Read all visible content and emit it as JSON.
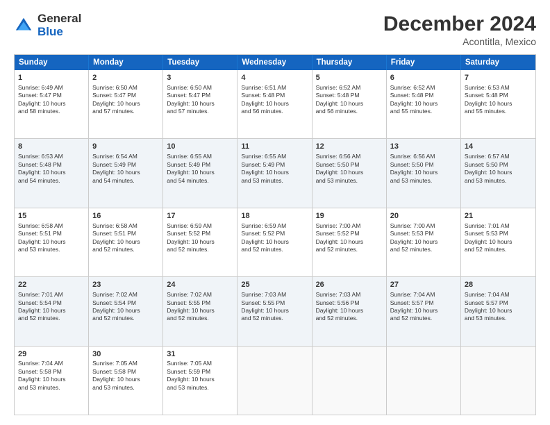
{
  "logo": {
    "general": "General",
    "blue": "Blue"
  },
  "header": {
    "month": "December 2024",
    "location": "Acontitla, Mexico"
  },
  "days": [
    "Sunday",
    "Monday",
    "Tuesday",
    "Wednesday",
    "Thursday",
    "Friday",
    "Saturday"
  ],
  "rows": [
    [
      {
        "day": "1",
        "lines": [
          "Sunrise: 6:49 AM",
          "Sunset: 5:47 PM",
          "Daylight: 10 hours",
          "and 58 minutes."
        ]
      },
      {
        "day": "2",
        "lines": [
          "Sunrise: 6:50 AM",
          "Sunset: 5:47 PM",
          "Daylight: 10 hours",
          "and 57 minutes."
        ]
      },
      {
        "day": "3",
        "lines": [
          "Sunrise: 6:50 AM",
          "Sunset: 5:47 PM",
          "Daylight: 10 hours",
          "and 57 minutes."
        ]
      },
      {
        "day": "4",
        "lines": [
          "Sunrise: 6:51 AM",
          "Sunset: 5:48 PM",
          "Daylight: 10 hours",
          "and 56 minutes."
        ]
      },
      {
        "day": "5",
        "lines": [
          "Sunrise: 6:52 AM",
          "Sunset: 5:48 PM",
          "Daylight: 10 hours",
          "and 56 minutes."
        ]
      },
      {
        "day": "6",
        "lines": [
          "Sunrise: 6:52 AM",
          "Sunset: 5:48 PM",
          "Daylight: 10 hours",
          "and 55 minutes."
        ]
      },
      {
        "day": "7",
        "lines": [
          "Sunrise: 6:53 AM",
          "Sunset: 5:48 PM",
          "Daylight: 10 hours",
          "and 55 minutes."
        ]
      }
    ],
    [
      {
        "day": "8",
        "lines": [
          "Sunrise: 6:53 AM",
          "Sunset: 5:48 PM",
          "Daylight: 10 hours",
          "and 54 minutes."
        ]
      },
      {
        "day": "9",
        "lines": [
          "Sunrise: 6:54 AM",
          "Sunset: 5:49 PM",
          "Daylight: 10 hours",
          "and 54 minutes."
        ]
      },
      {
        "day": "10",
        "lines": [
          "Sunrise: 6:55 AM",
          "Sunset: 5:49 PM",
          "Daylight: 10 hours",
          "and 54 minutes."
        ]
      },
      {
        "day": "11",
        "lines": [
          "Sunrise: 6:55 AM",
          "Sunset: 5:49 PM",
          "Daylight: 10 hours",
          "and 53 minutes."
        ]
      },
      {
        "day": "12",
        "lines": [
          "Sunrise: 6:56 AM",
          "Sunset: 5:50 PM",
          "Daylight: 10 hours",
          "and 53 minutes."
        ]
      },
      {
        "day": "13",
        "lines": [
          "Sunrise: 6:56 AM",
          "Sunset: 5:50 PM",
          "Daylight: 10 hours",
          "and 53 minutes."
        ]
      },
      {
        "day": "14",
        "lines": [
          "Sunrise: 6:57 AM",
          "Sunset: 5:50 PM",
          "Daylight: 10 hours",
          "and 53 minutes."
        ]
      }
    ],
    [
      {
        "day": "15",
        "lines": [
          "Sunrise: 6:58 AM",
          "Sunset: 5:51 PM",
          "Daylight: 10 hours",
          "and 53 minutes."
        ]
      },
      {
        "day": "16",
        "lines": [
          "Sunrise: 6:58 AM",
          "Sunset: 5:51 PM",
          "Daylight: 10 hours",
          "and 52 minutes."
        ]
      },
      {
        "day": "17",
        "lines": [
          "Sunrise: 6:59 AM",
          "Sunset: 5:52 PM",
          "Daylight: 10 hours",
          "and 52 minutes."
        ]
      },
      {
        "day": "18",
        "lines": [
          "Sunrise: 6:59 AM",
          "Sunset: 5:52 PM",
          "Daylight: 10 hours",
          "and 52 minutes."
        ]
      },
      {
        "day": "19",
        "lines": [
          "Sunrise: 7:00 AM",
          "Sunset: 5:52 PM",
          "Daylight: 10 hours",
          "and 52 minutes."
        ]
      },
      {
        "day": "20",
        "lines": [
          "Sunrise: 7:00 AM",
          "Sunset: 5:53 PM",
          "Daylight: 10 hours",
          "and 52 minutes."
        ]
      },
      {
        "day": "21",
        "lines": [
          "Sunrise: 7:01 AM",
          "Sunset: 5:53 PM",
          "Daylight: 10 hours",
          "and 52 minutes."
        ]
      }
    ],
    [
      {
        "day": "22",
        "lines": [
          "Sunrise: 7:01 AM",
          "Sunset: 5:54 PM",
          "Daylight: 10 hours",
          "and 52 minutes."
        ]
      },
      {
        "day": "23",
        "lines": [
          "Sunrise: 7:02 AM",
          "Sunset: 5:54 PM",
          "Daylight: 10 hours",
          "and 52 minutes."
        ]
      },
      {
        "day": "24",
        "lines": [
          "Sunrise: 7:02 AM",
          "Sunset: 5:55 PM",
          "Daylight: 10 hours",
          "and 52 minutes."
        ]
      },
      {
        "day": "25",
        "lines": [
          "Sunrise: 7:03 AM",
          "Sunset: 5:55 PM",
          "Daylight: 10 hours",
          "and 52 minutes."
        ]
      },
      {
        "day": "26",
        "lines": [
          "Sunrise: 7:03 AM",
          "Sunset: 5:56 PM",
          "Daylight: 10 hours",
          "and 52 minutes."
        ]
      },
      {
        "day": "27",
        "lines": [
          "Sunrise: 7:04 AM",
          "Sunset: 5:57 PM",
          "Daylight: 10 hours",
          "and 52 minutes."
        ]
      },
      {
        "day": "28",
        "lines": [
          "Sunrise: 7:04 AM",
          "Sunset: 5:57 PM",
          "Daylight: 10 hours",
          "and 53 minutes."
        ]
      }
    ],
    [
      {
        "day": "29",
        "lines": [
          "Sunrise: 7:04 AM",
          "Sunset: 5:58 PM",
          "Daylight: 10 hours",
          "and 53 minutes."
        ]
      },
      {
        "day": "30",
        "lines": [
          "Sunrise: 7:05 AM",
          "Sunset: 5:58 PM",
          "Daylight: 10 hours",
          "and 53 minutes."
        ]
      },
      {
        "day": "31",
        "lines": [
          "Sunrise: 7:05 AM",
          "Sunset: 5:59 PM",
          "Daylight: 10 hours",
          "and 53 minutes."
        ]
      },
      {
        "day": "",
        "lines": []
      },
      {
        "day": "",
        "lines": []
      },
      {
        "day": "",
        "lines": []
      },
      {
        "day": "",
        "lines": []
      }
    ]
  ]
}
